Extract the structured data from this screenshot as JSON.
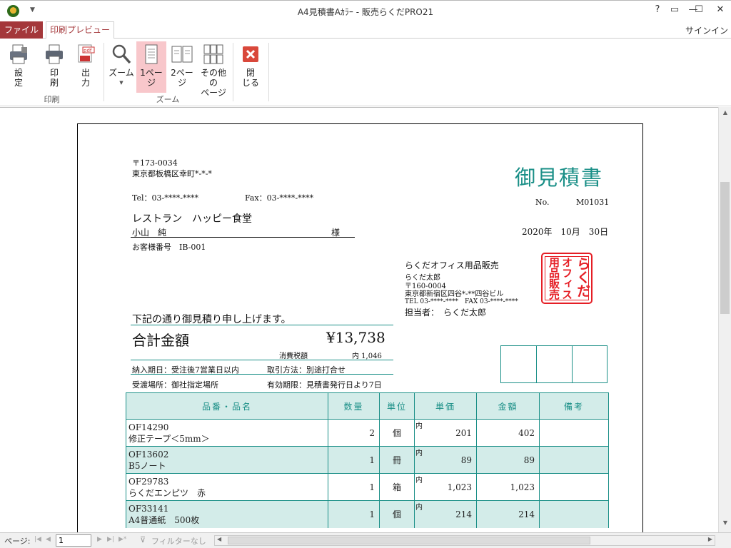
{
  "window": {
    "title": "A4見積書Aｶﾗｰ - 販売らくだPRO21",
    "help": "?",
    "restore": "▭",
    "minimize": "—",
    "maximize": "☐",
    "close": "✕"
  },
  "tabs": {
    "file": "ファイル",
    "print_preview": "印刷プレビュー",
    "signin": "サインイン"
  },
  "ribbon": {
    "print_group": "印刷",
    "zoom_group": "ズーム",
    "settings": "設\n定",
    "print": "印\n刷",
    "output": "出\n力",
    "zoom": "ズーム",
    "one_page": "1ペー\nジ",
    "two_pages": "2ペー\nジ",
    "other_pages": "その他の\nページ",
    "close": "閉\nじる"
  },
  "document": {
    "postal": "〒173-0034",
    "address": "東京都板橋区幸町*-*-*",
    "tel": "Tel：03-****-****",
    "fax": "Fax：03-****-****",
    "title": "御見積書",
    "no_label": "No.",
    "no_value": "M01031",
    "customer": "レストラン　ハッピー食堂",
    "contact": "小山　純",
    "honorific": "様",
    "customer_no": "お客様番号　IB-001",
    "date": "2020年　10月　30日",
    "company": "らくだオフィス用品販売",
    "rep": "らくだ太郎",
    "company_postal": "〒160-0004",
    "company_address": "東京都新宿区四谷*-**四谷ビル",
    "company_tel": "TEL 03-****-****　FAX 03-****-****",
    "person_in_charge": "担当者：　らくだ太郎",
    "stamp_right": "らくだ",
    "stamp_middle": "オフィス",
    "stamp_left": "用品販売",
    "intro": "下記の通り御見積り申し上げます。",
    "total_label": "合計金額",
    "total_value": "¥13,738",
    "tax_label": "消費税額",
    "tax_value": "内 1,046",
    "delivery": "納入期日：受注後7営業日以内",
    "payment": "取引方法：別途打合せ",
    "place": "受渡場所：御社指定場所",
    "validity": "有効期限：見積書発行日より7日"
  },
  "table": {
    "headers": [
      "品番・品名",
      "数量",
      "単位",
      "単価",
      "金額",
      "備考"
    ],
    "rows": [
      {
        "code": "OF14290",
        "name": "修正テープ＜5mm＞",
        "qty": "2",
        "unit": "個",
        "tax": "内",
        "price": "201",
        "amount": "402",
        "note": ""
      },
      {
        "code": "OF13602",
        "name": "B5ノート",
        "qty": "1",
        "unit": "冊",
        "tax": "内",
        "price": "89",
        "amount": "89",
        "note": ""
      },
      {
        "code": "OF29783",
        "name": "らくだエンピツ　赤",
        "qty": "1",
        "unit": "箱",
        "tax": "内",
        "price": "1,023",
        "amount": "1,023",
        "note": ""
      },
      {
        "code": "OF33141",
        "name": "A4普通紙　500枚",
        "qty": "1",
        "unit": "個",
        "tax": "内",
        "price": "214",
        "amount": "214",
        "note": ""
      }
    ]
  },
  "status": {
    "page_label": "ページ:",
    "page_value": "1",
    "filter": "フィルターなし"
  },
  "colors": {
    "accent": "#a4373a",
    "teal": "#1a8f87",
    "stamp": "#e51e25",
    "active_button": "#f8c7cb"
  }
}
